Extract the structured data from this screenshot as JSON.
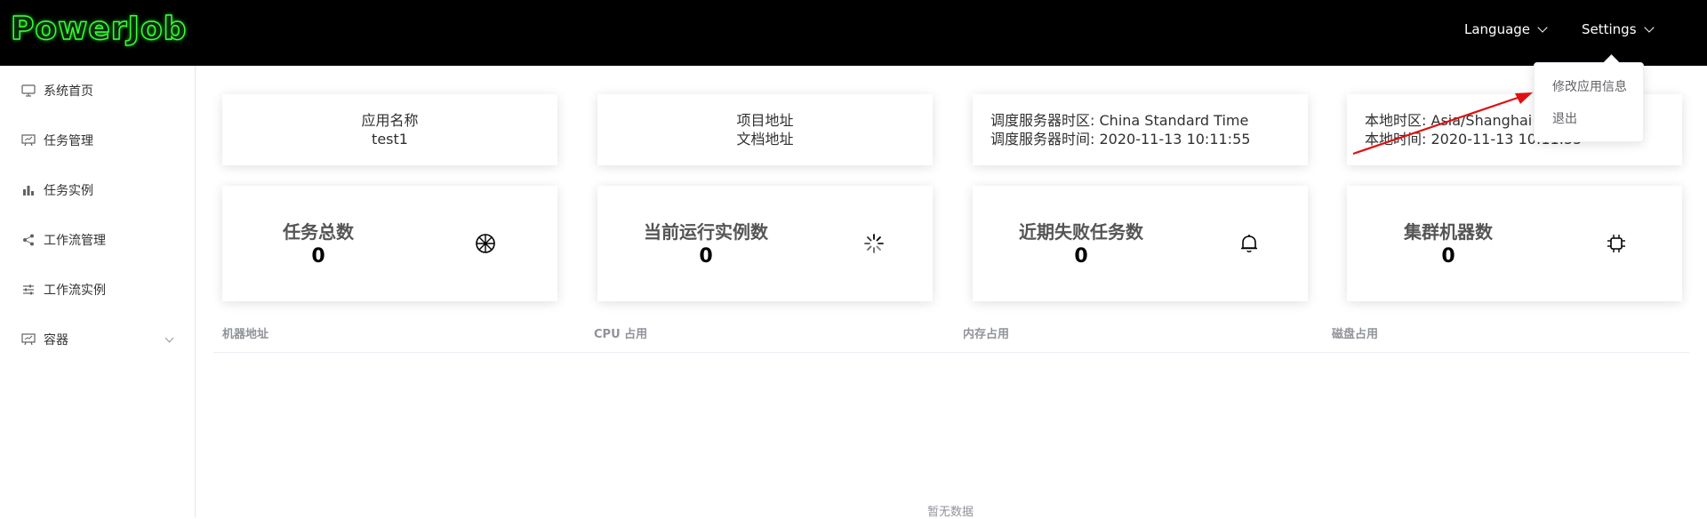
{
  "header": {
    "logo": "PowerJob",
    "language_label": "Language",
    "settings_label": "Settings"
  },
  "sidebar": {
    "items": [
      {
        "label": "系统首页",
        "icon": "monitor-icon"
      },
      {
        "label": "任务管理",
        "icon": "presentation-board-icon"
      },
      {
        "label": "任务实例",
        "icon": "bar-chart-icon"
      },
      {
        "label": "工作流管理",
        "icon": "share-icon"
      },
      {
        "label": "工作流实例",
        "icon": "sliders-icon"
      },
      {
        "label": "容器",
        "icon": "presentation-board-icon"
      }
    ]
  },
  "info_cards": {
    "app": {
      "title": "应用名称",
      "value": "test1"
    },
    "links": {
      "project": "项目地址",
      "docs": "文档地址"
    },
    "server": {
      "timezone_label": "调度服务器时区:",
      "timezone": "China Standard Time",
      "time_label": "调度服务器时间:",
      "time": "2020-11-13 10:11:55"
    },
    "local": {
      "timezone_label": "本地时区:",
      "timezone": "Asia/Shanghai",
      "time_label": "本地时间:",
      "time": "2020-11-13 10:11:55"
    }
  },
  "stats": [
    {
      "title": "任务总数",
      "value": "0",
      "icon": "wheel-icon"
    },
    {
      "title": "当前运行实例数",
      "value": "0",
      "icon": "loading-icon"
    },
    {
      "title": "近期失败任务数",
      "value": "0",
      "icon": "bell-icon"
    },
    {
      "title": "集群机器数",
      "value": "0",
      "icon": "cpu-icon"
    }
  ],
  "table": {
    "columns": [
      "机器地址",
      "CPU 占用",
      "内存占用",
      "磁盘占用"
    ],
    "empty_text": "暂无数据"
  },
  "settings_dropdown": {
    "items": [
      "修改应用信息",
      "退出"
    ]
  },
  "colors": {
    "header_bg": "#000000",
    "logo_green": "#3cff3c",
    "annotation_arrow": "#e01010"
  }
}
